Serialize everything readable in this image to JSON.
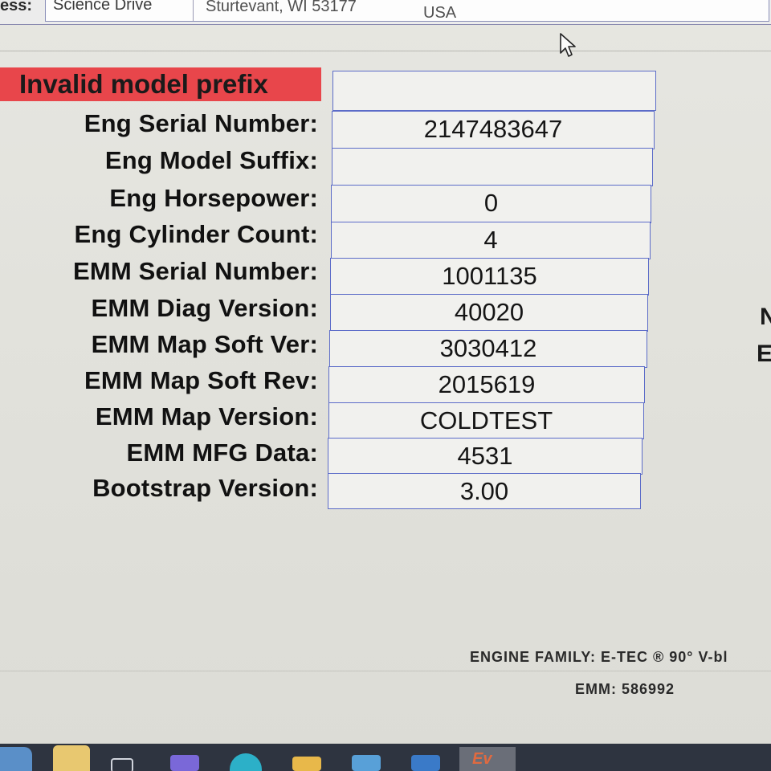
{
  "address": {
    "label": "ess:",
    "street": "Science Drive",
    "city": "Sturtevant, WI 53177",
    "country": "USA"
  },
  "error": {
    "label": "Invalid model prefix",
    "value": ""
  },
  "fields": [
    {
      "label": "Eng Serial Number:",
      "value": "2147483647"
    },
    {
      "label": "Eng Model Suffix:",
      "value": ""
    },
    {
      "label": "Eng Horsepower:",
      "value": "0"
    },
    {
      "label": "Eng Cylinder Count:",
      "value": "4"
    },
    {
      "label": "EMM Serial Number:",
      "value": "1001135"
    },
    {
      "label": "EMM Diag Version:",
      "value": "40020"
    },
    {
      "label": "EMM Map Soft Ver:",
      "value": "3030412"
    },
    {
      "label": "EMM Map Soft Rev:",
      "value": "2015619"
    },
    {
      "label": "EMM Map Version:",
      "value": "COLDTEST"
    },
    {
      "label": "EMM MFG Data:",
      "value": "4531"
    },
    {
      "label": "Bootstrap Version:",
      "value": "3.00"
    }
  ],
  "footer": {
    "engine_family": "ENGINE FAMILY: E-TEC ® 90° V-bl",
    "emm": "EMM: 586992"
  },
  "right_edge_glyphs": [
    "N",
    "E"
  ],
  "taskbar": {
    "active_app": "Ev"
  },
  "colors": {
    "error_bg": "#e8464b",
    "cell_border": "#5c6cc8",
    "taskbar_bg": "#2e3440"
  }
}
